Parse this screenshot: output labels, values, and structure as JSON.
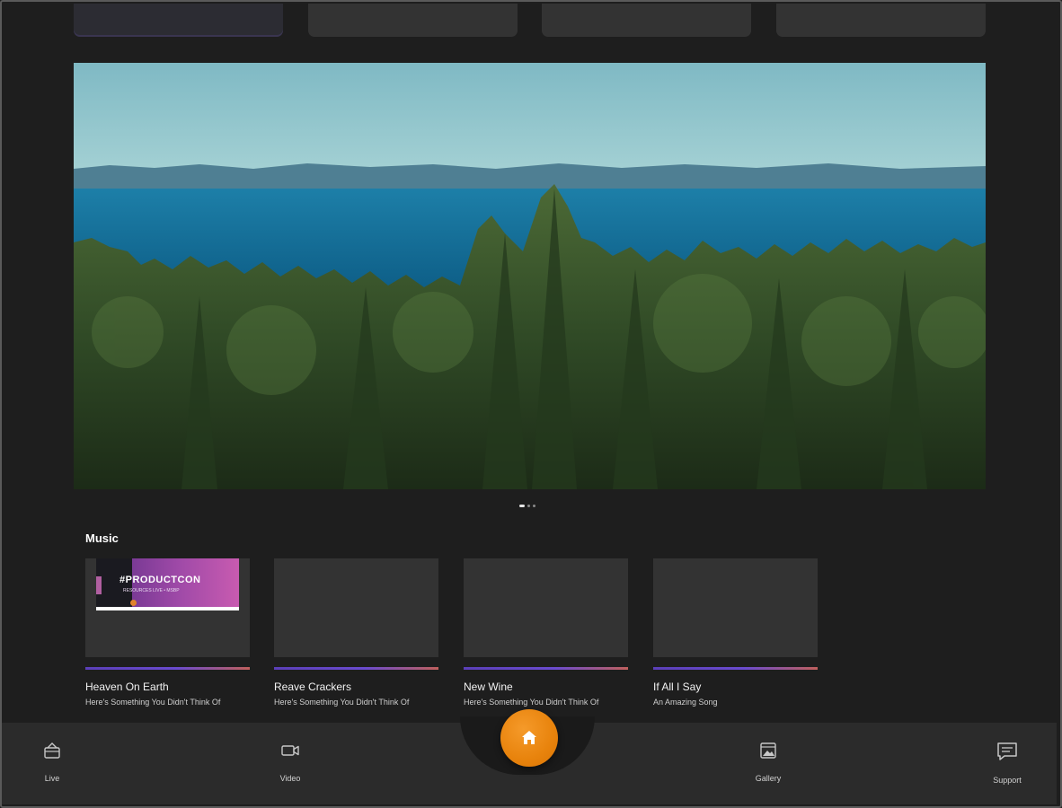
{
  "top_tabs": [
    {
      "id": "tab-1",
      "active": true
    },
    {
      "id": "tab-2",
      "active": false
    },
    {
      "id": "tab-3",
      "active": false
    },
    {
      "id": "tab-4",
      "active": false
    }
  ],
  "hero": {
    "icon": "forest-sea-landscape-photo",
    "slide_count": 3,
    "active_slide": 1
  },
  "music": {
    "section_title": "Music",
    "cards": [
      {
        "title": "Heaven On Earth",
        "subtitle": "Here's Something You Didn't Think Of",
        "thumb": "promo",
        "promo_text": "#PRODUCTCON",
        "promo_sub": "RESOURCES LIVE • MSBP"
      },
      {
        "title": "Reave Crackers",
        "subtitle": "Here's Something You Didn't Think Of",
        "thumb": "blank"
      },
      {
        "title": "New Wine",
        "subtitle": "Here's Something You Didn't Think Of",
        "thumb": "blank"
      },
      {
        "title": "If All I Say",
        "subtitle": "An Amazing Song",
        "thumb": "blank"
      }
    ]
  },
  "nav": {
    "items": [
      {
        "label": "Live",
        "icon": "live-broadcast-icon"
      },
      {
        "label": "Video",
        "icon": "video-camera-icon"
      },
      {
        "label": "Gallery",
        "icon": "gallery-image-icon"
      },
      {
        "label": "Support",
        "icon": "chat-bubble-icon"
      }
    ],
    "home": {
      "icon": "home-icon",
      "color": "#e8830c"
    }
  },
  "colors": {
    "background": "#1e1e1e",
    "card": "#333333",
    "accent": "#e8830c",
    "progress_start": "#5b3fb9",
    "progress_end": "#c0605d"
  }
}
